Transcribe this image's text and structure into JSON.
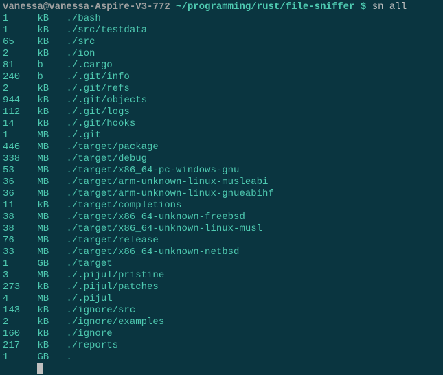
{
  "prompt": {
    "user_host": "vanessa@vanessa-Aspire-V3-772",
    "cwd": "~/programming/rust/file-sniffer",
    "dollar": "$",
    "command": "sn all"
  },
  "rows": [
    {
      "size": "1",
      "unit": "kB",
      "path": "./bash"
    },
    {
      "size": "1",
      "unit": "kB",
      "path": "./src/testdata"
    },
    {
      "size": "65",
      "unit": "kB",
      "path": "./src"
    },
    {
      "size": "2",
      "unit": "kB",
      "path": "./ion"
    },
    {
      "size": "81",
      "unit": "b",
      "path": "./.cargo"
    },
    {
      "size": "240",
      "unit": "b",
      "path": "./.git/info"
    },
    {
      "size": "2",
      "unit": "kB",
      "path": "./.git/refs"
    },
    {
      "size": "944",
      "unit": "kB",
      "path": "./.git/objects"
    },
    {
      "size": "112",
      "unit": "kB",
      "path": "./.git/logs"
    },
    {
      "size": "14",
      "unit": "kB",
      "path": "./.git/hooks"
    },
    {
      "size": "1",
      "unit": "MB",
      "path": "./.git"
    },
    {
      "size": "446",
      "unit": "MB",
      "path": "./target/package"
    },
    {
      "size": "338",
      "unit": "MB",
      "path": "./target/debug"
    },
    {
      "size": "53",
      "unit": "MB",
      "path": "./target/x86_64-pc-windows-gnu"
    },
    {
      "size": "36",
      "unit": "MB",
      "path": "./target/arm-unknown-linux-musleabi"
    },
    {
      "size": "36",
      "unit": "MB",
      "path": "./target/arm-unknown-linux-gnueabihf"
    },
    {
      "size": "11",
      "unit": "kB",
      "path": "./target/completions"
    },
    {
      "size": "38",
      "unit": "MB",
      "path": "./target/x86_64-unknown-freebsd"
    },
    {
      "size": "38",
      "unit": "MB",
      "path": "./target/x86_64-unknown-linux-musl"
    },
    {
      "size": "76",
      "unit": "MB",
      "path": "./target/release"
    },
    {
      "size": "33",
      "unit": "MB",
      "path": "./target/x86_64-unknown-netbsd"
    },
    {
      "size": "1",
      "unit": "GB",
      "path": "./target"
    },
    {
      "size": "3",
      "unit": "MB",
      "path": "./.pijul/pristine"
    },
    {
      "size": "273",
      "unit": "kB",
      "path": "./.pijul/patches"
    },
    {
      "size": "4",
      "unit": "MB",
      "path": "./.pijul"
    },
    {
      "size": "143",
      "unit": "kB",
      "path": "./ignore/src"
    },
    {
      "size": "2",
      "unit": "kB",
      "path": "./ignore/examples"
    },
    {
      "size": "160",
      "unit": "kB",
      "path": "./ignore"
    },
    {
      "size": "217",
      "unit": "kB",
      "path": "./reports"
    },
    {
      "size": "1",
      "unit": "GB",
      "path": "."
    }
  ]
}
